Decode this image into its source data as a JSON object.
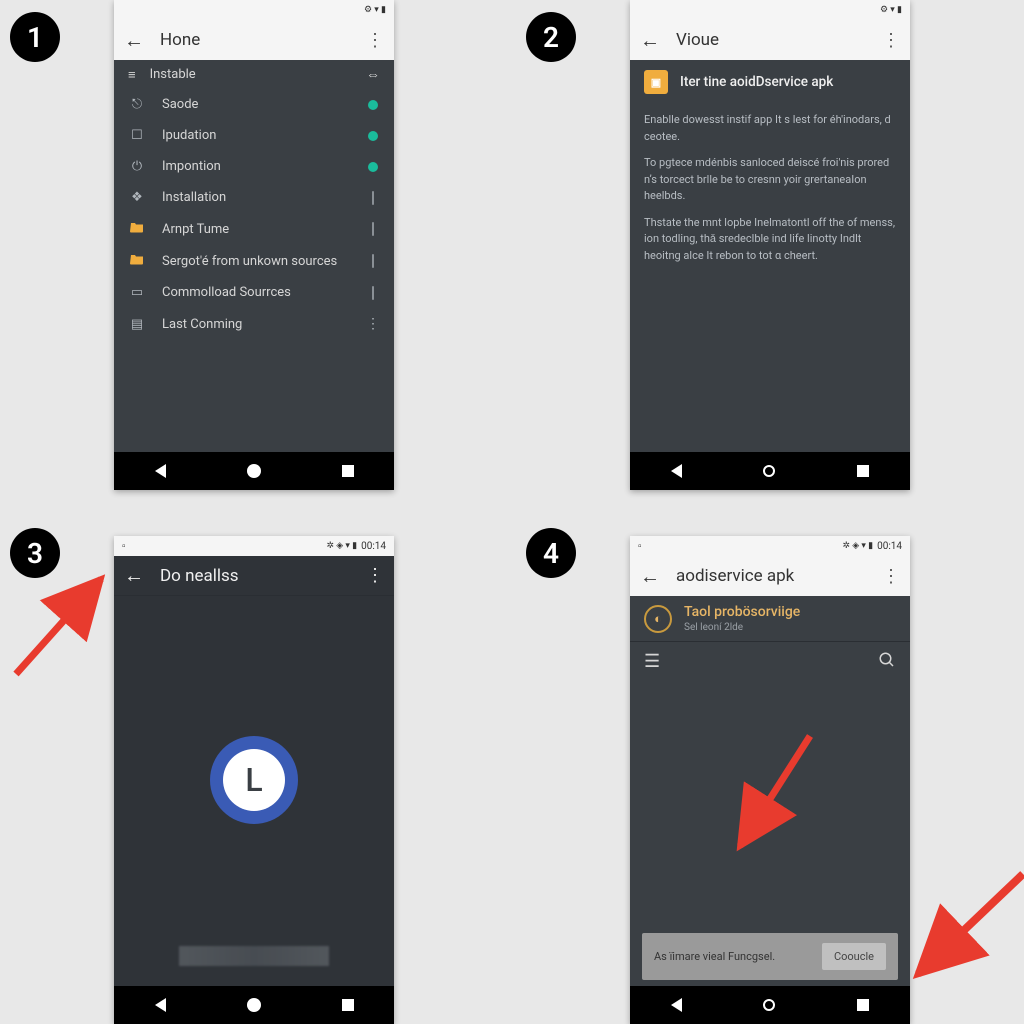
{
  "steps": [
    "1",
    "2",
    "3",
    "4"
  ],
  "status": {
    "icons": "⚙ ▾ ▮",
    "time": "00:14"
  },
  "panel1": {
    "title": "Hone",
    "section": "Instable",
    "rows": [
      {
        "icon": "⎋",
        "label": "Saode",
        "trailing": "dot"
      },
      {
        "icon": "☐",
        "label": "Ipudation",
        "trailing": "dot"
      },
      {
        "icon": "⏻",
        "label": "Impontion",
        "trailing": "dot"
      },
      {
        "icon": "❖",
        "label": "Installation",
        "trailing": "tick"
      },
      {
        "icon": "folder",
        "label": "Arnpt Tume",
        "trailing": "tick"
      },
      {
        "icon": "folder",
        "label": "Sergot'é from unkown sources",
        "trailing": "tick"
      },
      {
        "icon": "▭",
        "label": "Commolload Sourrces",
        "trailing": "tick"
      },
      {
        "icon": "▤",
        "label": "Last Conming",
        "trailing": "dots"
      }
    ]
  },
  "panel2": {
    "title": "Vioue",
    "info_title": "Iter tine aoidDservice apk",
    "para1": "Enablle dowesst instif app It s lest for éh'inodars, d ceotee.",
    "para2": "To pgtece mdénbis sanloced deiscé froi'nis prored nʼs torcect brlle be to cresnn yoir grertaneaIon heelbds.",
    "para3": "Thstate the mnt lopbe Inelmatontl off the of menss, ion todling, thǎ sredeclble ind life linotty Indlt heoitng alce It rebon to tot α cheert."
  },
  "panel3": {
    "title": "Do neallss",
    "big_letter": "L"
  },
  "panel4": {
    "title": "aodiservice apk",
    "file_name": "Taol probösorviige",
    "file_sub": "Sel leoní 2lde",
    "snackbar_text": "As ïimare vieal Funcgsel.",
    "snackbar_action": "Cooucle"
  }
}
